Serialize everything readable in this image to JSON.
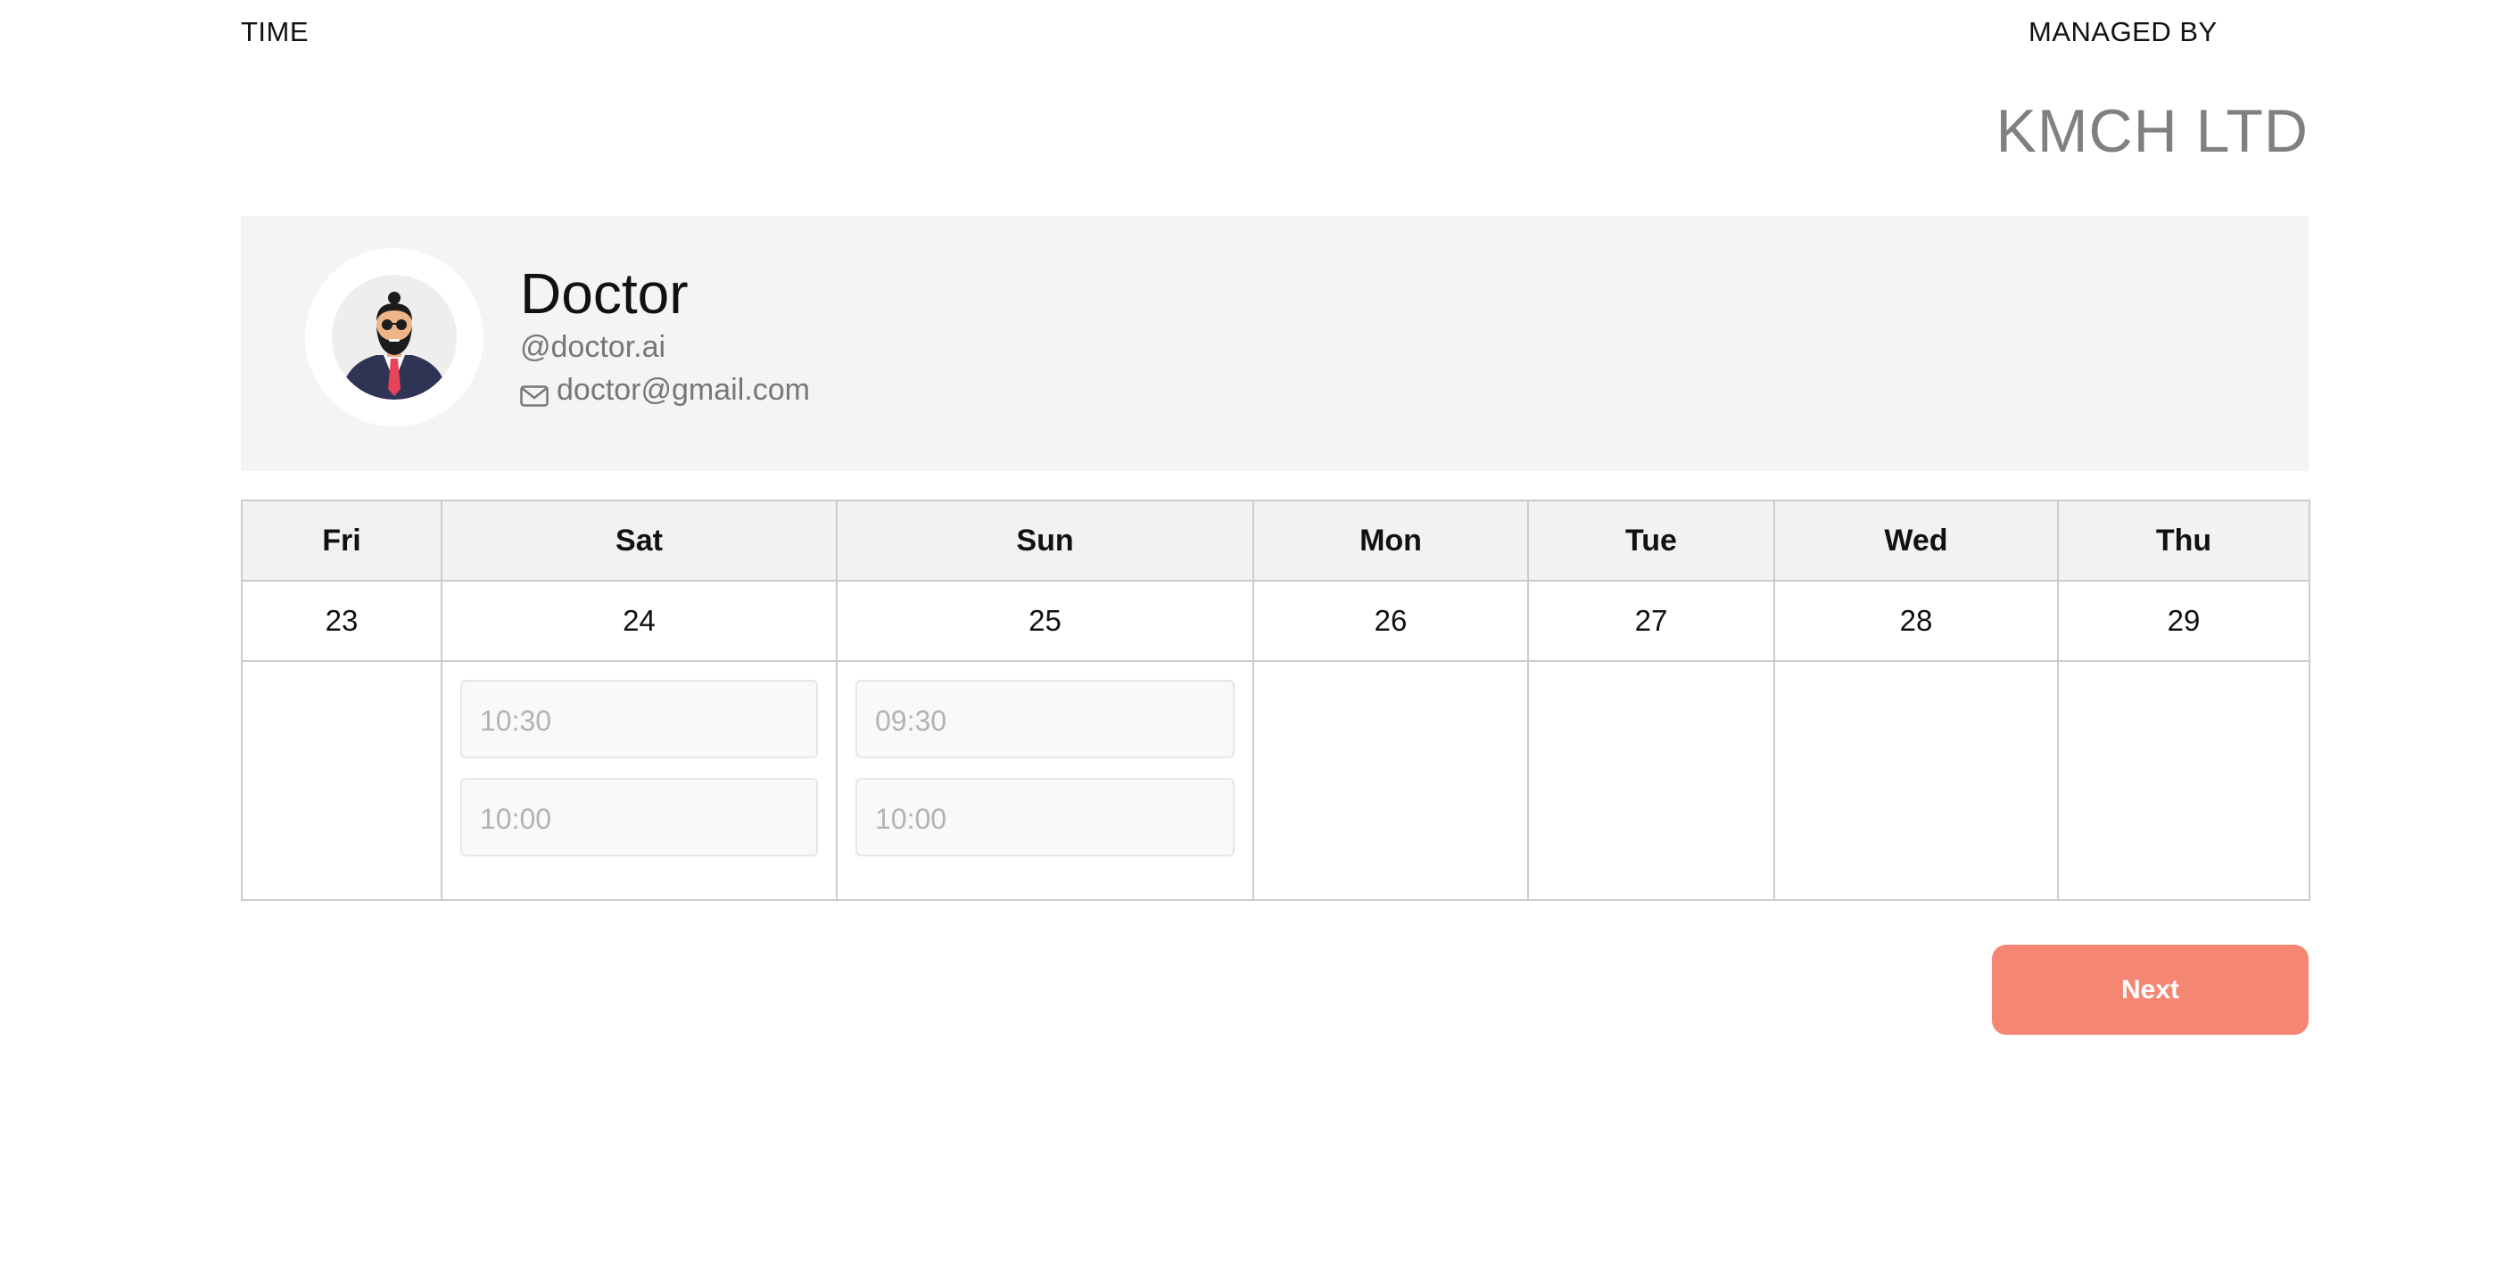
{
  "header": {
    "time_label": "TIME",
    "managed_by_label": "MANAGED BY",
    "company_name": "KMCH LTD"
  },
  "profile": {
    "name": "Doctor",
    "handle": "@doctor.ai",
    "email": "doctor@gmail.com",
    "avatar_icon": "doctor-avatar",
    "email_icon": "envelope-icon"
  },
  "calendar": {
    "days": [
      {
        "day": "Fri",
        "date": "23",
        "slots": []
      },
      {
        "day": "Sat",
        "date": "24",
        "slots": [
          "10:30",
          "10:00"
        ]
      },
      {
        "day": "Sun",
        "date": "25",
        "slots": [
          "09:30",
          "10:00"
        ]
      },
      {
        "day": "Mon",
        "date": "26",
        "slots": []
      },
      {
        "day": "Tue",
        "date": "27",
        "slots": []
      },
      {
        "day": "Wed",
        "date": "28",
        "slots": []
      },
      {
        "day": "Thu",
        "date": "29",
        "slots": []
      }
    ]
  },
  "actions": {
    "next_label": "Next"
  },
  "colors": {
    "accent": "#f58673",
    "card_bg": "#f4f4f4",
    "muted_text": "#808080"
  }
}
